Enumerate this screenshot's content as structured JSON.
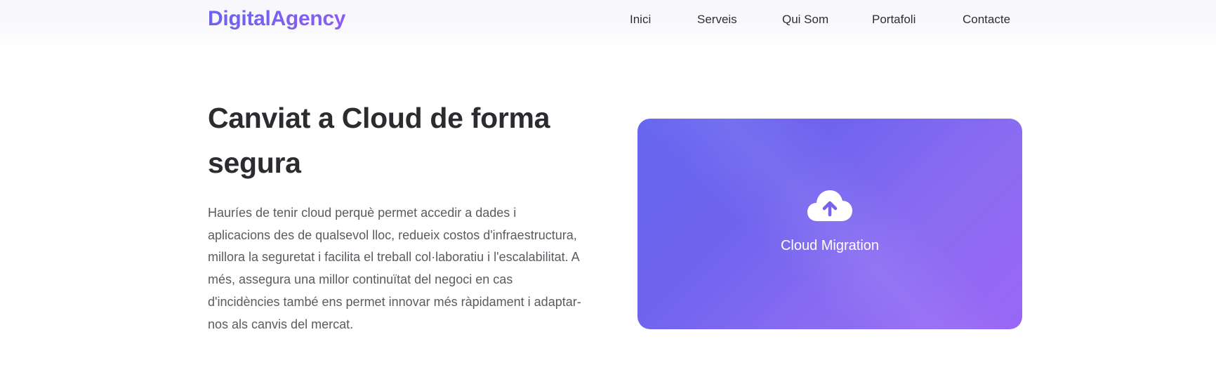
{
  "header": {
    "logo": "DigitalAgency",
    "nav": [
      {
        "label": "Inici"
      },
      {
        "label": "Serveis"
      },
      {
        "label": "Qui Som"
      },
      {
        "label": "Portafoli"
      },
      {
        "label": "Contacte"
      }
    ]
  },
  "hero": {
    "title": "Canviat a Cloud de forma segura",
    "text": "Hauríes de tenir cloud perquè permet accedir a dades i aplicacions des de qualsevol lloc, redueix costos d'infraestructura, millora la seguretat i facilita el treball col·laboratiu i l'escalabilitat. A més, assegura una millor continuïtat del negoci en cas d'incidències també ens permet innovar més ràpidament i adaptar-nos als canvis del mercat."
  },
  "card": {
    "icon": "cloud-upload-icon",
    "label": "Cloud Migration"
  },
  "colors": {
    "brand_start": "#6a64ee",
    "brand_end": "#8b5cf6",
    "card_start": "#6866f0",
    "card_end": "#9a66f6"
  }
}
